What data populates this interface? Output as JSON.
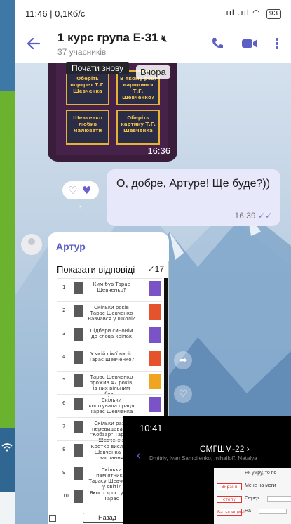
{
  "status": {
    "time_and_speed": "11:46 | 0,1Кб/с",
    "signal": ".ııl .ııl",
    "battery": "93"
  },
  "header": {
    "title": "1 курс група Е-31",
    "members": "37 учасників"
  },
  "top_image": {
    "button_label": "Почати знову",
    "date_pill": "Вчора",
    "time": "16:36",
    "cards": [
      "Оберіть портрет Т.Г. Шевченка",
      "В якому році народився Т.Г. Шевченко?",
      "Шевченко любив малювати",
      "Оберіть картину Т.Г. Шевченка"
    ]
  },
  "outgoing": {
    "text": "О, добре, Артуре! Ще буде?))",
    "time": "16:39",
    "reaction_count": "1"
  },
  "incoming": {
    "sender": "Артур",
    "sheet_title": "Показати відповіді",
    "sheet_count": "✓17",
    "rows": [
      {
        "num": "1",
        "q": "Ким був Тарас Шевченко?"
      },
      {
        "num": "2",
        "q": "Скільки років Тарас Шевченко навчався у школі?"
      },
      {
        "num": "3",
        "q": "Підбери синонім до слова кріпак"
      },
      {
        "num": "4",
        "q": "У якій сім'ї виріс Тарас Шевченко?"
      },
      {
        "num": "5",
        "q": "Тарас Шевченко прожив 47 років, із них вільним був…"
      },
      {
        "num": "6",
        "q": "Скільки коштувала праця Тарас Шевченка"
      },
      {
        "num": "7",
        "q": "Скільки разів перевидавався \"Кобзар\" Тараса Шевченка"
      },
      {
        "num": "8",
        "q": "Кротко вислали Шевченка на заслання"
      },
      {
        "num": "9",
        "q": "Скільки пам'ятників Тарасу Шевченку у світі?"
      },
      {
        "num": "10",
        "q": "Якого зросту був Тарас"
      }
    ],
    "footer_button": "Назад"
  },
  "overlay": {
    "time": "10:41",
    "chat_title": "СМГШМ-22 ›",
    "members": "Dmitriy, Ivan Samoilenko, mihailoff, Natalya",
    "lines": [
      "Як умру, то по",
      "Мене на моги",
      "Серед",
      "На"
    ],
    "labels": [
      "Вкраїні",
      "степу",
      "Батьківщині"
    ]
  },
  "colors": {
    "accent": "#5c5fc4",
    "outgoing_bubble": "#e7e9fb",
    "heart": "#6b5fd0"
  }
}
